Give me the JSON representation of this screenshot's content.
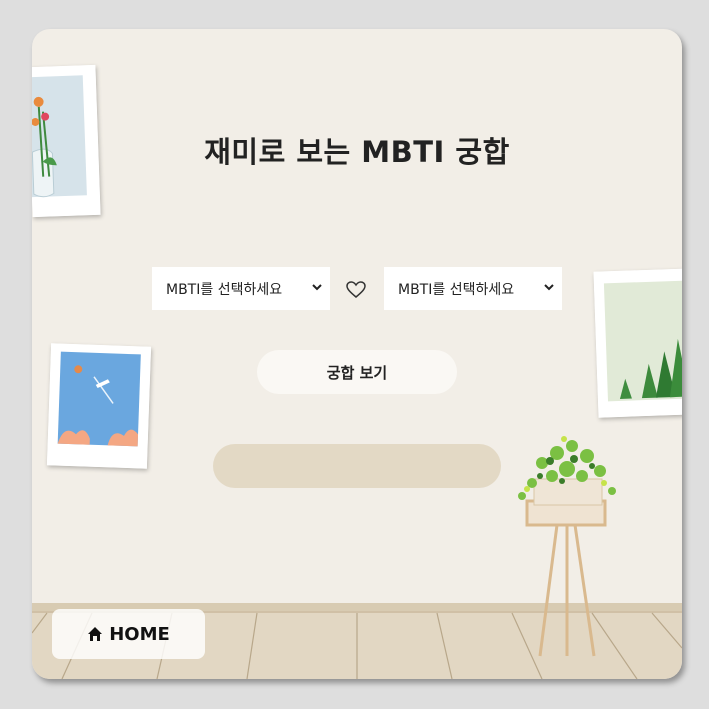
{
  "page": {
    "title": "재미로 보는 MBTI 궁합"
  },
  "compat_form": {
    "left_select": {
      "selected": "MBTI를 선택하세요"
    },
    "right_select": {
      "selected": "MBTI를 선택하세요"
    },
    "separator_icon": "heart-outline-icon",
    "submit_label": "궁합 보기",
    "result_text": ""
  },
  "nav": {
    "home_icon": "home-icon",
    "home_label": "HOME"
  },
  "colors": {
    "background": "#f2eee7",
    "outer": "#dedede",
    "result_box": "#e3d9c5",
    "floor": "#e2d7c3"
  }
}
